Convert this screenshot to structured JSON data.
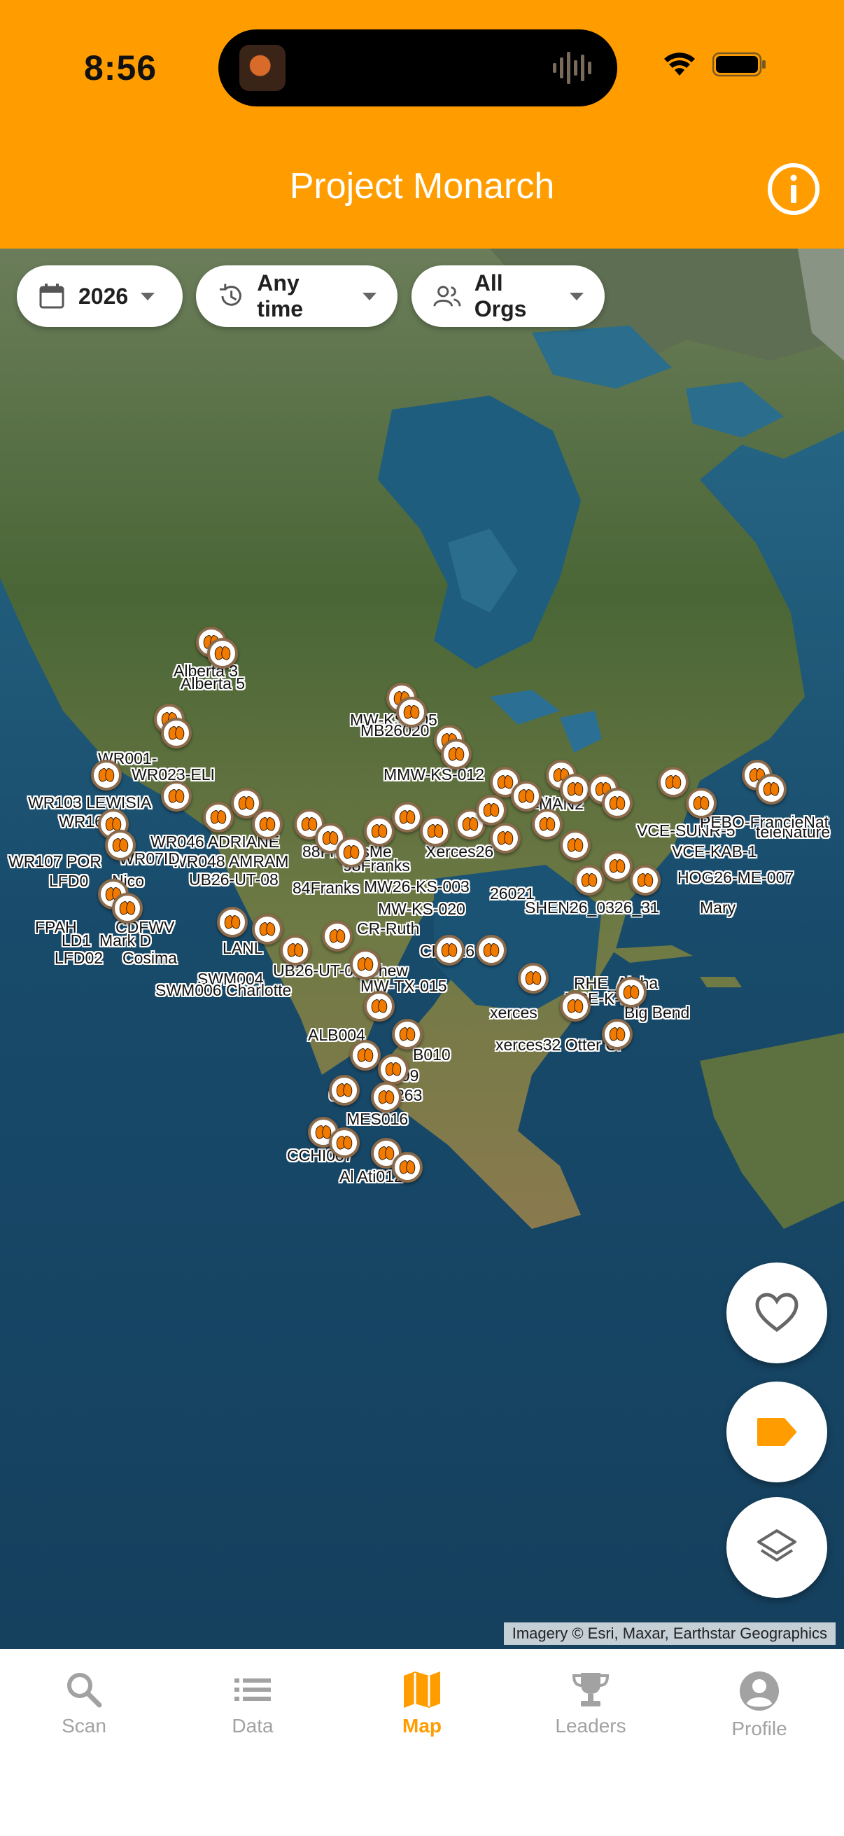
{
  "status_bar": {
    "time": "8:56",
    "icons": [
      "wifi-icon",
      "battery-icon"
    ]
  },
  "header": {
    "title": "Project Monarch",
    "info_icon": "info-icon",
    "background_color": "#FF9D00"
  },
  "filters": [
    {
      "icon": "calendar-icon",
      "label": "2026"
    },
    {
      "icon": "history-icon",
      "label": "Any time"
    },
    {
      "icon": "people-icon",
      "label": "All Orgs"
    }
  ],
  "map": {
    "marker_icon": "monarch-butterfly-icon",
    "labels": [
      "Alberta 3",
      "Alberta 5",
      "MW-KS-005",
      "MB26020",
      "MMW-KS-012",
      "WR001-",
      "WR023-ELI",
      "WR103 LEWISIA",
      "WR164",
      "WR046 ADRIANE",
      "WR048 AMRAM",
      "WR107 POR",
      "WR07ID",
      "LFD0",
      "Nico",
      "UB26-UT-08",
      "88FranksMe",
      "98Franks",
      "84Franks",
      "Xerces26",
      "MW26-KS-003",
      "MW-KS-020",
      "CR-Ruth",
      "SHEN26_0326_31",
      "ON",
      "MAN2",
      "VCE-SUNR-5",
      "teieNature",
      "VCE-KAB-1",
      "HOG26-ME-007",
      "FPAH",
      "CDFWV",
      "LD1",
      "Mark D",
      "LFD02",
      "Cosima",
      "LANL",
      "UB26-UT-06 Chew",
      "SWM004",
      "SWM006 Charlotte",
      "CHI016",
      "MW-TX-015",
      "RHE_Alpha",
      "VCE-K-9",
      "Big Bend",
      "xerces",
      "xerces32 Otter Cr",
      "ALB004",
      "B010",
      "009",
      "OJ",
      "263",
      "MES016",
      "CCHI007",
      "Al Ati012",
      "Mary",
      "PEBO-FrancieNat",
      "26021"
    ],
    "attribution": "Imagery © Esri, Maxar, Earthstar Geographics"
  },
  "fabs": [
    {
      "icon": "heart-icon",
      "label": "favorites"
    },
    {
      "icon": "tag-icon",
      "label": "labels"
    },
    {
      "icon": "layers-icon",
      "label": "map layers"
    }
  ],
  "bottom_nav": {
    "active": "Map",
    "items": [
      {
        "icon": "search-icon",
        "label": "Scan"
      },
      {
        "icon": "list-icon",
        "label": "Data"
      },
      {
        "icon": "map-icon",
        "label": "Map"
      },
      {
        "icon": "trophy-icon",
        "label": "Leaders"
      },
      {
        "icon": "account-icon",
        "label": "Profile"
      }
    ]
  },
  "colors": {
    "accent": "#FF9D00",
    "inactive": "#A2A2A2",
    "ocean": "#1A4A68",
    "land": "#4F6B3A"
  }
}
